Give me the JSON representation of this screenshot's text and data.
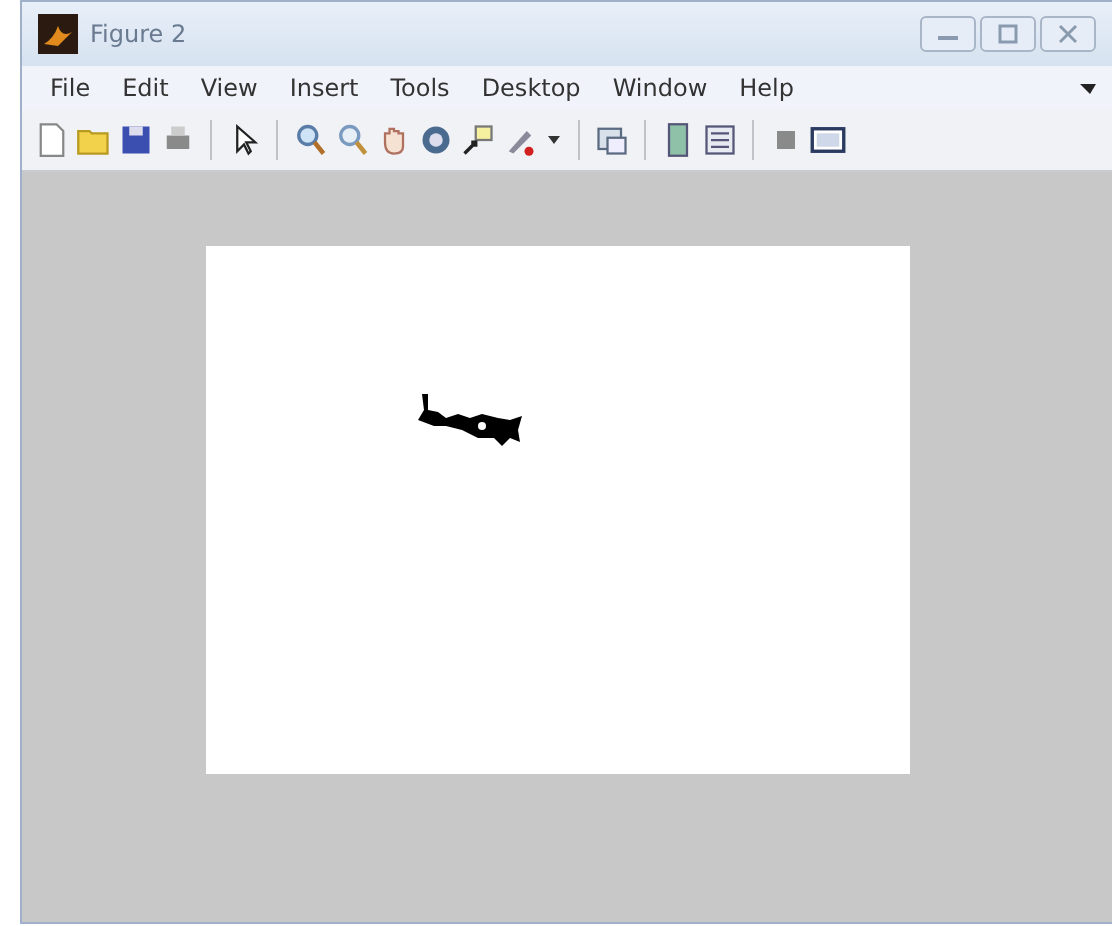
{
  "window": {
    "title": "Figure 2"
  },
  "menu": [
    {
      "label": "File"
    },
    {
      "label": "Edit"
    },
    {
      "label": "View"
    },
    {
      "label": "Insert"
    },
    {
      "label": "Tools"
    },
    {
      "label": "Desktop"
    },
    {
      "label": "Window"
    },
    {
      "label": "Help"
    }
  ]
}
